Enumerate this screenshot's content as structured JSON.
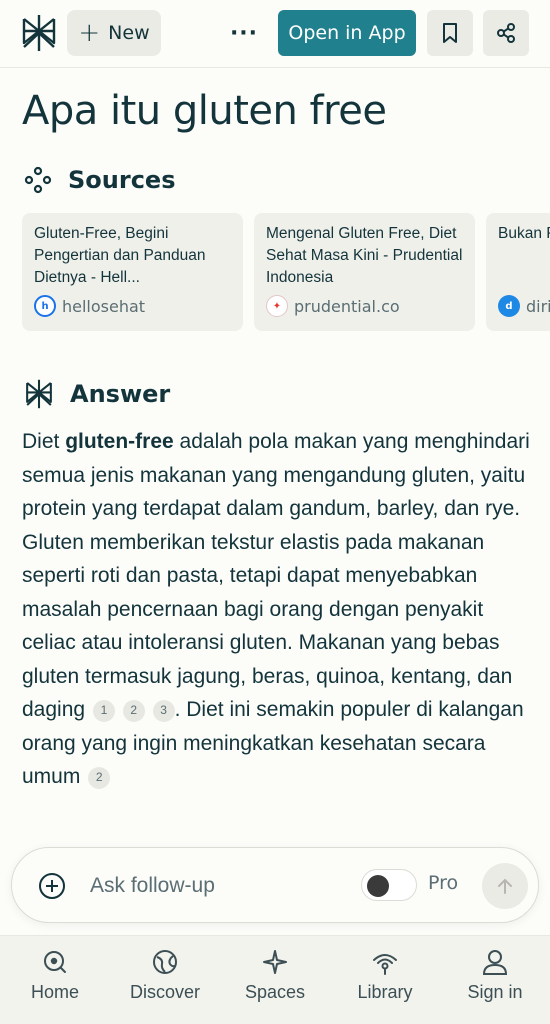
{
  "header": {
    "new_label": "New",
    "more_label": "···",
    "open_app_label": "Open in App"
  },
  "page": {
    "title": "Apa itu gluten free"
  },
  "sources": {
    "heading": "Sources",
    "cards": [
      {
        "title": "Gluten-Free, Begini Pengertian dan Panduan Dietnya - Hell...",
        "site": "hellosehat",
        "favicon_color": "#1a73e8"
      },
      {
        "title": "Mengenal Gluten Free, Diet Sehat Masa Kini - Prudential Indonesia",
        "site": "prudential.co",
        "favicon_color": "#e53935"
      },
      {
        "title": "Bukan Penjela & Mant",
        "site": "diri",
        "favicon_color": "#1e88e5"
      }
    ]
  },
  "answer": {
    "heading": "Answer",
    "p1_before": "Diet ",
    "p1_bold": "gluten-free",
    "p1_after": " adalah pola makan yang menghindari semua jenis makanan yang mengandung gluten, yaitu protein yang terdapat dalam gandum, barley, dan rye. Gluten memberikan tekstur elastis pada makanan seperti roti dan pasta, tetapi dapat menyebabkan masalah pencernaan bagi orang dengan penyakit celiac atau intoleransi gluten. Makanan yang bebas gluten termasuk jagung, beras, quinoa, kentang, dan daging",
    "cites_a": [
      "1",
      "2",
      "3"
    ],
    "p1_end": ". Diet ini semakin populer di kalangan orang yang ingin meningkatkan kesehatan secara umum",
    "cite_b": "2"
  },
  "followup": {
    "placeholder": "Ask follow-up",
    "pro_label": "Pro",
    "pro_enabled": false
  },
  "nav": {
    "items": [
      "Home",
      "Discover",
      "Spaces",
      "Library",
      "Sign in"
    ]
  },
  "colors": {
    "accent": "#20808d",
    "text": "#13343b",
    "background": "#fcfcf9"
  }
}
